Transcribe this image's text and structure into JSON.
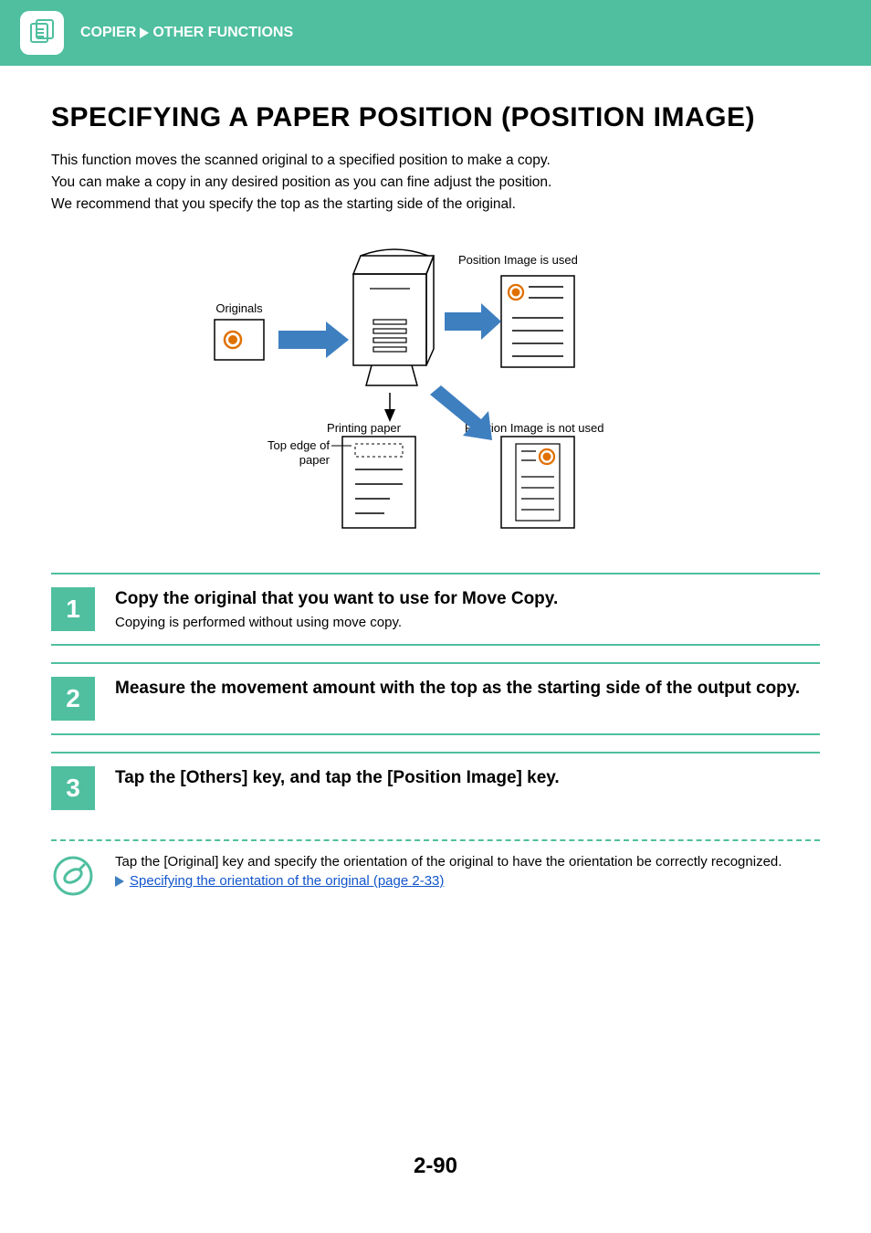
{
  "header": {
    "breadcrumb": {
      "section": "COPIER",
      "subsection": "OTHER FUNCTIONS"
    }
  },
  "title": "SPECIFYING A PAPER POSITION (POSITION IMAGE)",
  "intro": [
    "This function moves the scanned original to a specified position to make a copy.",
    "You can make a copy in any desired position as you can fine adjust the position.",
    "We recommend that you specify the top as the starting side of the original."
  ],
  "diagram": {
    "originals_label": "Originals",
    "position_used_label": "Position Image is used",
    "position_not_used_label": "Position Image is not used",
    "printing_paper_label": "Printing paper",
    "top_edge_label_line1": "Top edge of",
    "top_edge_label_line2": "paper"
  },
  "steps": [
    {
      "num": "1",
      "title": "Copy the original that you want to use for Move Copy.",
      "desc": "Copying is performed without using move copy."
    },
    {
      "num": "2",
      "title": "Measure the movement amount with the top as the starting side of the output copy.",
      "desc": ""
    },
    {
      "num": "3",
      "title": "Tap the [Others] key, and tap the [Position Image] key.",
      "desc": ""
    }
  ],
  "note": {
    "text": "Tap the [Original] key and specify the orientation of the original to have the orientation be correctly recognized.",
    "link_text": "Specifying the orientation of the original (page 2-33)"
  },
  "page_number": "2-90"
}
